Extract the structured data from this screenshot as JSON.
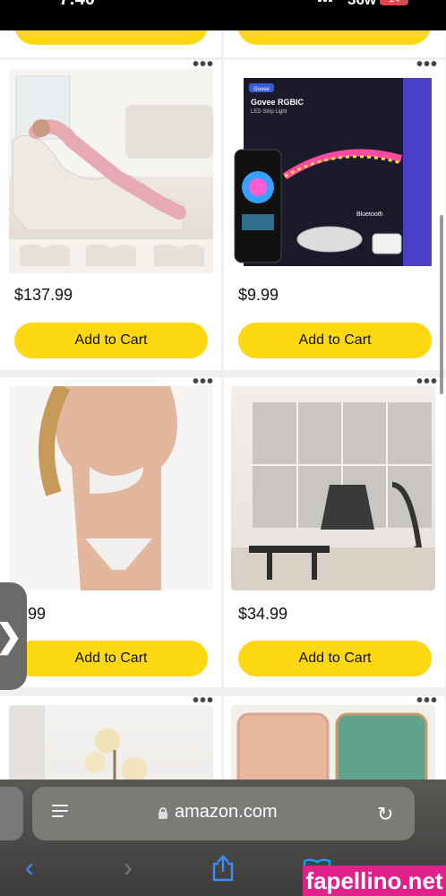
{
  "status_bar": {
    "time": "7:40",
    "network": "36w",
    "battery": "14"
  },
  "products": [
    {
      "price": "$137.99",
      "button": "Add to Cart",
      "more": "•••"
    },
    {
      "price": "$9.99",
      "button": "Add to Cart",
      "more": "•••",
      "image_text": {
        "brand": "Govee",
        "title": "Govee RGBIC",
        "subtitle": "LED Strip Light",
        "bluetooth": "Bluetooth"
      }
    },
    {
      "price": "2.99",
      "button": "Add to Cart",
      "more": "•••"
    },
    {
      "price": "$34.99",
      "button": "Add to Cart",
      "more": "•••"
    },
    {
      "more": "•••"
    },
    {
      "more": "•••"
    }
  ],
  "side_handle": {
    "icon": "chevron-right-icon",
    "glyph": "❯"
  },
  "browser": {
    "url": "amazon.com",
    "toolbar": {
      "back": "‹",
      "forward": "›",
      "share": "share-icon",
      "bookmarks": "book-icon",
      "tabs": "tabs-icon"
    }
  },
  "watermark": "fapellino.net",
  "colors": {
    "button_yellow": "#ffd814",
    "link_blue": "#3b8cff",
    "watermark_pink": "#e0218a"
  }
}
